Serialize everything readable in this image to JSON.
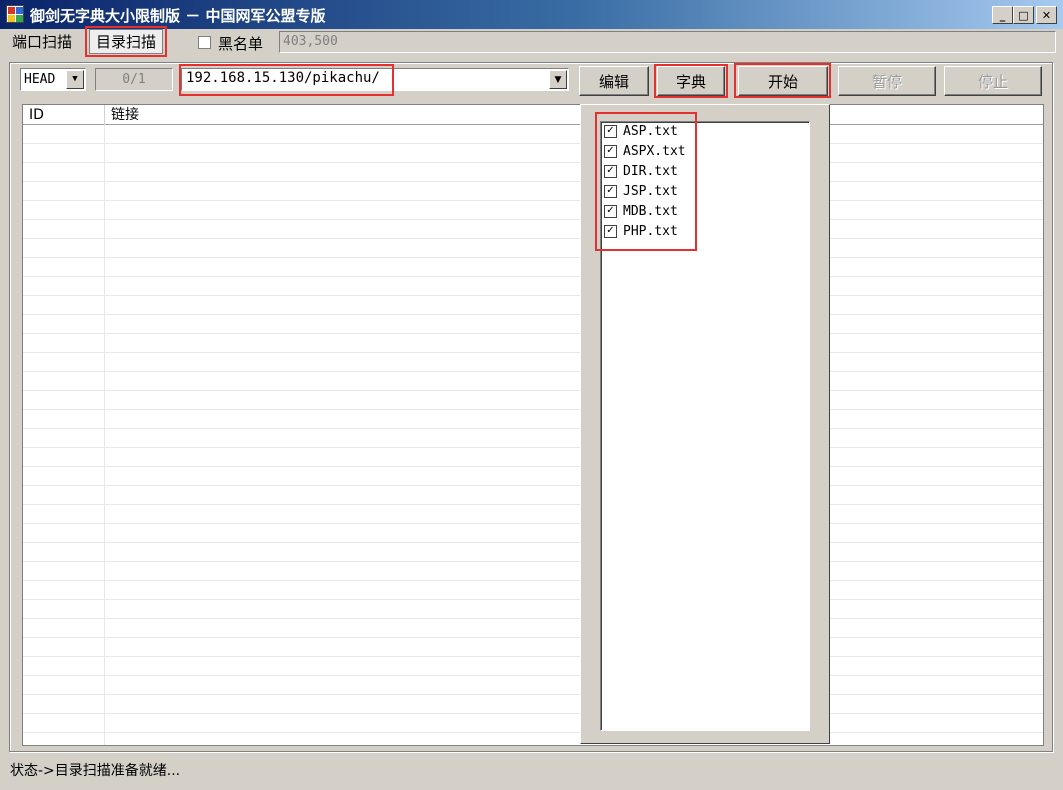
{
  "window": {
    "title": "御剑无字典大小限制版 － 中国网军公盟专版",
    "min_label": "_",
    "max_label": "□",
    "close_label": "✕"
  },
  "menu": {
    "port_scan": "端口扫描",
    "dir_scan": "目录扫描"
  },
  "blacklist": {
    "label": "黑名单",
    "checked": false,
    "value": "403,500"
  },
  "toolbar": {
    "method": "HEAD",
    "progress": "0/1",
    "url": "192.168.15.130/pikachu/",
    "edit_label": "编辑",
    "dict_label": "字典",
    "start_label": "开始",
    "pause_label": "暂停",
    "stop_label": "停止"
  },
  "list": {
    "columns": [
      "ID",
      "链接"
    ]
  },
  "dictionary": {
    "items": [
      {
        "label": "ASP.txt",
        "checked": true
      },
      {
        "label": "ASPX.txt",
        "checked": true
      },
      {
        "label": "DIR.txt",
        "checked": true
      },
      {
        "label": "JSP.txt",
        "checked": true
      },
      {
        "label": "MDB.txt",
        "checked": true
      },
      {
        "label": "PHP.txt",
        "checked": true
      }
    ]
  },
  "status": {
    "text": "状态->目录扫描准备就绪..."
  },
  "colors": {
    "highlight_box": "#e53030",
    "window_bg": "#d4d0c8",
    "title_start": "#0a246a",
    "title_end": "#a6caf0"
  }
}
